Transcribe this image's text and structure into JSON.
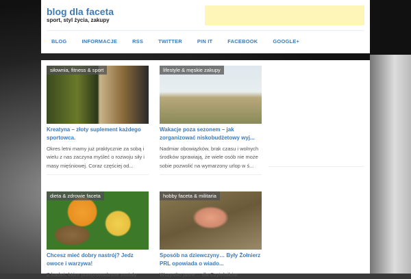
{
  "header": {
    "title": "blog dla faceta",
    "tagline": "sport, styl życia, zakupy"
  },
  "nav": [
    "BLOG",
    "INFORMACJE",
    "RSS",
    "TWITTER",
    "PIN IT",
    "FACEBOOK",
    "GOOGLE+"
  ],
  "posts": [
    {
      "category": "siłownia, fitness & sport",
      "title": "Kreatyna – złoty suplement każdego sportowca.",
      "excerpt": "Okres letni mamy już praktycznie za sobą i wielu z nas zaczyna myśleć o rozwoju siły i masy mięśniowej. Coraz częściej od..."
    },
    {
      "category": "lifestyle & męskie zakupy",
      "title": "Wakacje poza sezonem – jak zorganizować niskobudżetowy wyj...",
      "excerpt": "Nadmiar obowiązków, brak czasu i wolnych środków sprawiają, że wiele osób nie może sobie pozwolić na wymarzony urlop w ś..."
    },
    {
      "category": "dieta & zdrowie faceta",
      "title": "Chcesz mieć dobry nastrój? Jedz owoce i warzywa!",
      "excerpt": "Z badań, które przeprowadzone zostały"
    },
    {
      "category": "hobby faceta & militaria",
      "title": "Sposób na dziewczyny… Były Żołnierz PRL opowiada o wiado...",
      "excerpt": "Wszystko jasne… dla Czytelników"
    }
  ]
}
